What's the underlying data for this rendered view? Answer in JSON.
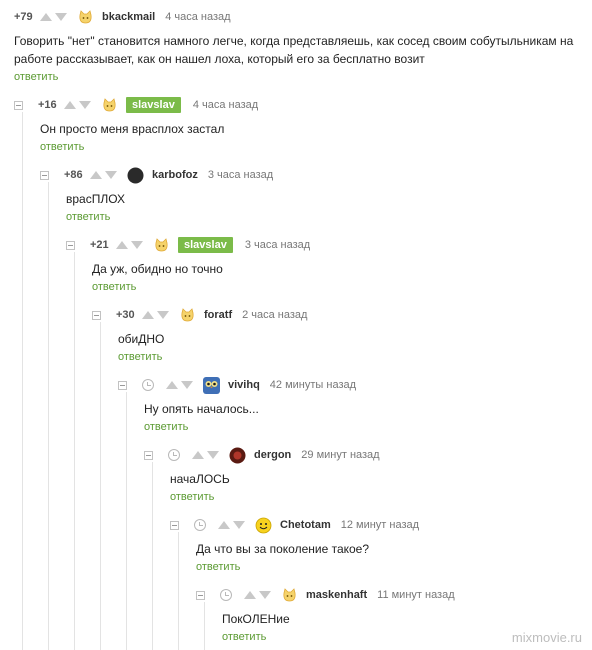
{
  "colors": {
    "accent": "#7bbb49",
    "reply_link": "#5b9a32",
    "text": "#222222",
    "muted": "#777777"
  },
  "comments": [
    {
      "rating": "+79",
      "author": "bkackmail",
      "time": "4 часа назад",
      "text": "Говорить \"нет\" становится намного легче, когда представляешь, как сосед своим собутыльникам на работе рассказывает, как он нашел лоха, который его за бесплатно возит",
      "reply": "ответить",
      "avatar_icon": "cat-face-icon"
    },
    {
      "rating": "+16",
      "author": "slavslav",
      "time": "4 часа назад",
      "text": "Он просто меня  врасплох застал",
      "reply": "ответить",
      "avatar_icon": "cat-face-icon",
      "author_highlighted": true
    },
    {
      "rating": "+86",
      "author": "karbofoz",
      "time": "3 часа назад",
      "text": "врасПЛОХ",
      "reply": "ответить",
      "avatar_icon": "dark-circle-avatar"
    },
    {
      "rating": "+21",
      "author": "slavslav",
      "time": "3 часа назад",
      "text": "Да уж,  обидно но точно",
      "reply": "ответить",
      "avatar_icon": "cat-face-icon",
      "author_highlighted": true
    },
    {
      "rating": "+30",
      "author": "foratf",
      "time": "2 часа назад",
      "text": "обиДНО",
      "reply": "ответить",
      "avatar_icon": "cat-face-icon"
    },
    {
      "rating": "",
      "author": "vivihq",
      "time": "42 минуты назад",
      "text": "Ну опять началось...",
      "reply": "ответить",
      "avatar_icon": "blue-owl-avatar",
      "pending": true
    },
    {
      "rating": "",
      "author": "dergon",
      "time": "29 минут назад",
      "text": "начаЛОСЬ",
      "reply": "ответить",
      "avatar_icon": "red-dark-avatar",
      "pending": true
    },
    {
      "rating": "",
      "author": "Chetotam",
      "time": "12 минут назад",
      "text": "Да что вы за поколение такое?",
      "reply": "ответить",
      "avatar_icon": "smiley-icon",
      "pending": true
    },
    {
      "rating": "",
      "author": "maskenhaft",
      "time": "11 минут назад",
      "text": "ПокОЛЕНие",
      "reply": "ответить",
      "avatar_icon": "cat-face-icon",
      "pending": true
    }
  ],
  "watermark": "mixmovie.ru"
}
